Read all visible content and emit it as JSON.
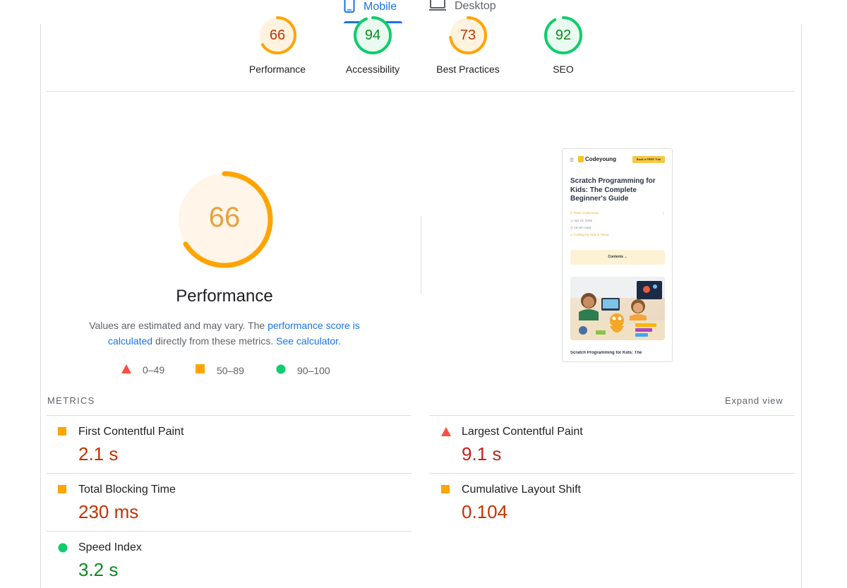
{
  "tabs": [
    {
      "label": "Mobile",
      "icon": "phone-icon",
      "active": true
    },
    {
      "label": "Desktop",
      "icon": "laptop-icon",
      "active": false
    }
  ],
  "categories": [
    {
      "score": "66",
      "label": "Performance",
      "color": "#ffa400",
      "fraction": 0.66
    },
    {
      "score": "94",
      "label": "Accessibility",
      "color": "#0cce6b",
      "fraction": 0.94
    },
    {
      "score": "73",
      "label": "Best Practices",
      "color": "#ffa400",
      "fraction": 0.73
    },
    {
      "score": "92",
      "label": "SEO",
      "color": "#0cce6b",
      "fraction": 0.92
    }
  ],
  "performance": {
    "score": "66",
    "fraction": 0.66,
    "title": "Performance",
    "desc_1": "Values are estimated and may vary. The ",
    "desc_link_1": "performance score is calculated",
    "desc_2": " directly from these metrics. ",
    "desc_link_2": "See calculator",
    "desc_3": "."
  },
  "legend": [
    {
      "range": "0–49",
      "shape": "triangle",
      "color": "#ff4e42"
    },
    {
      "range": "50–89",
      "shape": "square",
      "color": "#ffa400"
    },
    {
      "range": "90–100",
      "shape": "circle",
      "color": "#0cce6b"
    }
  ],
  "thumbnail": {
    "logo": "Codeyoung",
    "cta": "Book a FREE Trial",
    "title": "Scratch Programming for Kids: The Complete Beginner's Guide",
    "author": "Team Codeyoung",
    "date": "Apr 13, 2026",
    "read_time": "16 min read",
    "category": "Coding For Kids & Teens",
    "contents": "Contents",
    "footer": "Scratch Programming for Kids: The"
  },
  "metrics": {
    "title": "METRICS",
    "expand": "Expand view",
    "items": [
      {
        "label": "First Contentful Paint",
        "value": "2.1 s",
        "status": "average"
      },
      {
        "label": "Largest Contentful Paint",
        "value": "9.1 s",
        "status": "fail"
      },
      {
        "label": "Total Blocking Time",
        "value": "230 ms",
        "status": "average"
      },
      {
        "label": "Cumulative Layout Shift",
        "value": "0.104",
        "status": "average"
      },
      {
        "label": "Speed Index",
        "value": "3.2 s",
        "status": "pass"
      }
    ]
  }
}
